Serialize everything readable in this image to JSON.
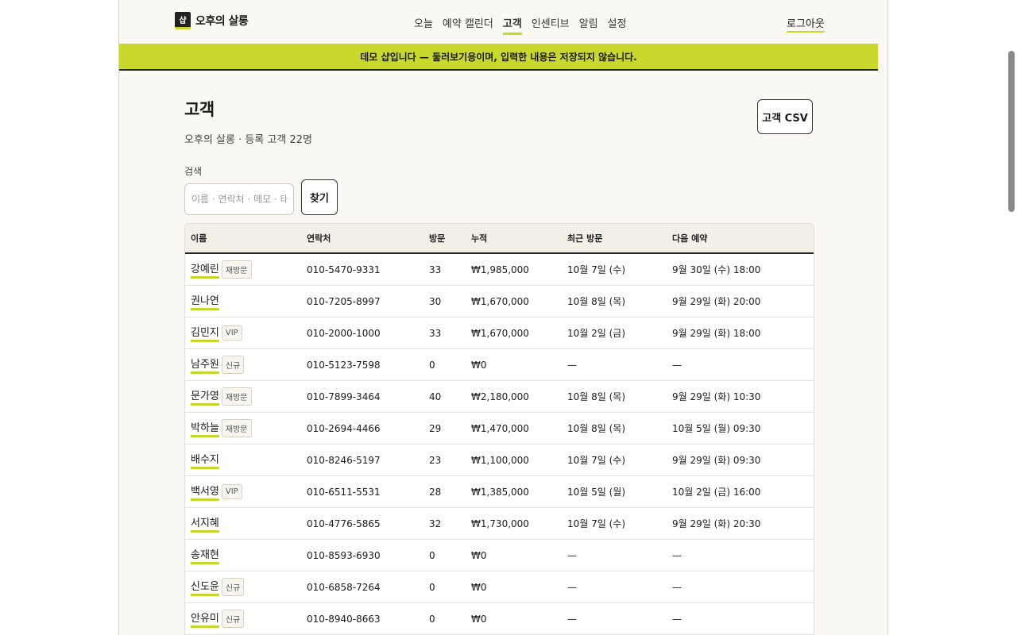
{
  "app": {
    "logo_mark": "샵",
    "name": "오후의 살롱"
  },
  "nav": {
    "items": [
      "오늘",
      "예약 캘린더",
      "고객",
      "인센티브",
      "알림",
      "설정"
    ],
    "active": "고객",
    "logout": "로그아웃"
  },
  "banner": "데모 샵입니다 — 둘러보기용이며, 입력한 내용은 저장되지 않습니다.",
  "page": {
    "title": "고객",
    "subtitle": "오후의 살롱 · 등록 고객 22명",
    "csv_button": "고객 CSV"
  },
  "search": {
    "label": "검색",
    "placeholder": "이름 · 연락처 · 메모 · 태그",
    "button": "찾기"
  },
  "table": {
    "headers": [
      "이름",
      "연락처",
      "방문",
      "누적",
      "최근 방문",
      "다음 예약"
    ],
    "rows": [
      {
        "name": "강예린",
        "tag": "재방문",
        "phone": "010-5470-9331",
        "visits": "33",
        "total": "₩1,985,000",
        "last": "10월 7일 (수)",
        "next": "9월 30일 (수) 18:00"
      },
      {
        "name": "권나연",
        "tag": "",
        "phone": "010-7205-8997",
        "visits": "30",
        "total": "₩1,670,000",
        "last": "10월 8일 (목)",
        "next": "9월 29일 (화) 20:00"
      },
      {
        "name": "김민지",
        "tag": "VIP",
        "phone": "010-2000-1000",
        "visits": "33",
        "total": "₩1,670,000",
        "last": "10월 2일 (금)",
        "next": "9월 29일 (화) 18:00"
      },
      {
        "name": "남주원",
        "tag": "신규",
        "phone": "010-5123-7598",
        "visits": "0",
        "total": "₩0",
        "last": "—",
        "next": "—"
      },
      {
        "name": "문가영",
        "tag": "재방문",
        "phone": "010-7899-3464",
        "visits": "40",
        "total": "₩2,180,000",
        "last": "10월 8일 (목)",
        "next": "9월 29일 (화) 10:30"
      },
      {
        "name": "박하늘",
        "tag": "재방문",
        "phone": "010-2694-4466",
        "visits": "29",
        "total": "₩1,470,000",
        "last": "10월 8일 (목)",
        "next": "10월 5일 (월) 09:30"
      },
      {
        "name": "배수지",
        "tag": "",
        "phone": "010-8246-5197",
        "visits": "23",
        "total": "₩1,100,000",
        "last": "10월 7일 (수)",
        "next": "9월 29일 (화) 09:30"
      },
      {
        "name": "백서영",
        "tag": "VIP",
        "phone": "010-6511-5531",
        "visits": "28",
        "total": "₩1,385,000",
        "last": "10월 5일 (월)",
        "next": "10월 2일 (금) 16:00"
      },
      {
        "name": "서지혜",
        "tag": "",
        "phone": "010-4776-5865",
        "visits": "32",
        "total": "₩1,730,000",
        "last": "10월 7일 (수)",
        "next": "9월 29일 (화) 20:30"
      },
      {
        "name": "송재현",
        "tag": "",
        "phone": "010-8593-6930",
        "visits": "0",
        "total": "₩0",
        "last": "—",
        "next": "—"
      },
      {
        "name": "신도윤",
        "tag": "신규",
        "phone": "010-6858-7264",
        "visits": "0",
        "total": "₩0",
        "last": "—",
        "next": "—"
      },
      {
        "name": "안유미",
        "tag": "신규",
        "phone": "010-8940-8663",
        "visits": "0",
        "total": "₩0",
        "last": "—",
        "next": "—"
      }
    ]
  },
  "colors": {
    "accent": "#c8d82b",
    "banner": "#c9d92c",
    "background": "#faf8f3"
  }
}
